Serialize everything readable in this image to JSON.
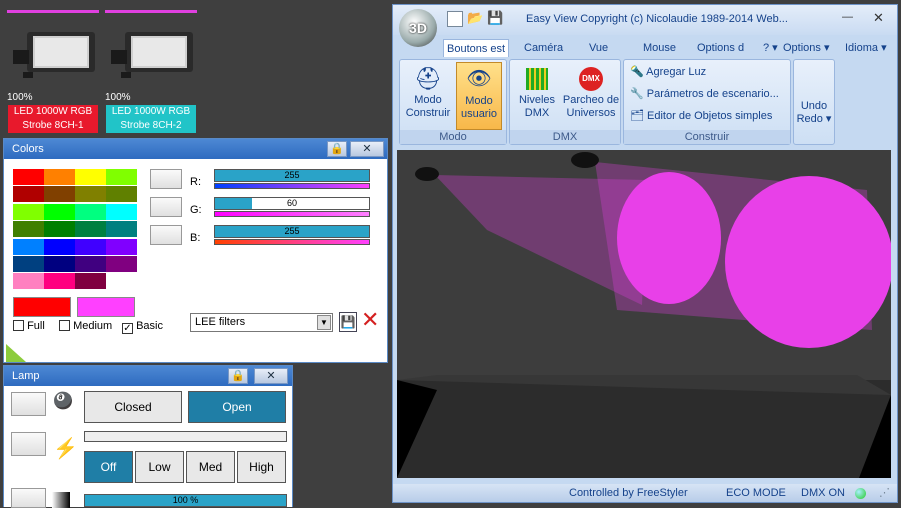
{
  "fixtures": [
    {
      "percent": "100%",
      "name_line1": "LED 1000W RGB",
      "name_line2": "Strobe 8CH-1",
      "label_color": "#e8192c"
    },
    {
      "percent": "100%",
      "name_line1": "LED 1000W RGB",
      "name_line2": "Strobe 8CH-2",
      "label_color": "#21c4c8"
    }
  ],
  "colors_panel": {
    "title": "Colors",
    "palette": [
      "#ff0000",
      "#ff8000",
      "#ffff00",
      "#80ff00",
      "#b00000",
      "#804000",
      "#808000",
      "#608000",
      "#80ff00",
      "#00ff00",
      "#00ff80",
      "#00ffff",
      "#408000",
      "#008000",
      "#008040",
      "#008080",
      "#0080ff",
      "#0000ff",
      "#4000ff",
      "#8000ff",
      "#004080",
      "#000080",
      "#400080",
      "#800080",
      "#ff80c0",
      "#ff0080",
      "#800040",
      "#ffffff"
    ],
    "current_color": "#ff0000",
    "target_color": "#ff40ff",
    "r_label": "R:",
    "r_value": "255",
    "r_level": 1.0,
    "g_label": "G:",
    "g_value": "60",
    "g_level": 0.24,
    "b_label": "B:",
    "b_value": "255",
    "b_level": 1.0,
    "full_label": "Full",
    "medium_label": "Medium",
    "basic_label": "Basic",
    "basic_checked": true,
    "filter_select": "LEE filters"
  },
  "lamp_panel": {
    "title": "Lamp",
    "closed_label": "Closed",
    "open_label": "Open",
    "off_label": "Off",
    "low_label": "Low",
    "med_label": "Med",
    "high_label": "High",
    "dimmer_value": "100 %",
    "dimmer_level": 1.0
  },
  "easyview": {
    "title": "Easy View   Copyright (c) Nicolaudie 1989-2014   Web...",
    "logo_text": "3D",
    "tabs": [
      "Boutons est",
      "Caméra",
      "Vue",
      "Mouse",
      "Options d"
    ],
    "help_menu": "?",
    "options_menu": "Options",
    "language_menu": "Idioma",
    "modo_group": "Modo",
    "modo_construir_line1": "Modo",
    "modo_construir_line2": "Construir",
    "modo_usuario_line1": "Modo",
    "modo_usuario_line2": "usuario",
    "dmx_group": "DMX",
    "niveles_line1": "Niveles",
    "niveles_line2": "DMX",
    "parcheo_line1": "Parcheo de",
    "parcheo_line2": "Universos",
    "construir_group": "Construir",
    "agregar_luz": "Agregar Luz",
    "parametros": "Parámetros de escenario...",
    "editor": "Editor de Objetos simples",
    "undo_line1": "Undo",
    "undo_line2": "Redo",
    "status_controlled": "Controlled by FreeStyler",
    "status_eco": "ECO MODE",
    "status_dmx": "DMX ON"
  }
}
